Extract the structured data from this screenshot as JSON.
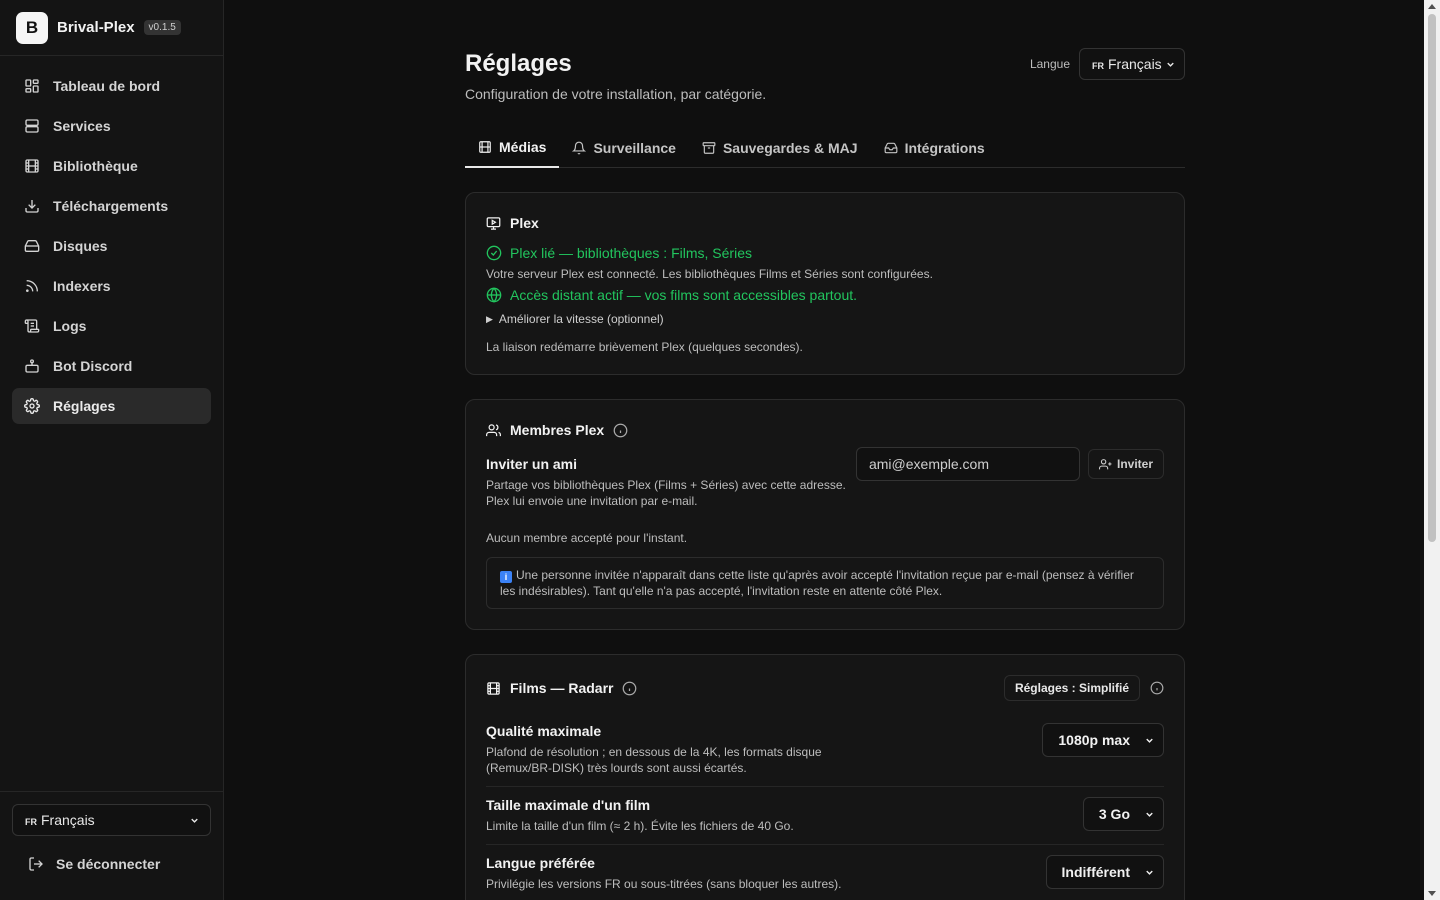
{
  "brand": {
    "logo_letter": "B",
    "name": "Brival-Plex",
    "version": "v0.1.5"
  },
  "sidebar": {
    "items": [
      {
        "label": "Tableau de bord",
        "icon": "dashboard-icon"
      },
      {
        "label": "Services",
        "icon": "server-icon"
      },
      {
        "label": "Bibliothèque",
        "icon": "film-icon"
      },
      {
        "label": "Téléchargements",
        "icon": "download-icon"
      },
      {
        "label": "Disques",
        "icon": "drive-icon"
      },
      {
        "label": "Indexers",
        "icon": "rss-icon"
      },
      {
        "label": "Logs",
        "icon": "logs-icon"
      },
      {
        "label": "Bot Discord",
        "icon": "bot-icon"
      },
      {
        "label": "Réglages",
        "icon": "gear-icon",
        "active": true
      }
    ],
    "language": {
      "flag": "FR",
      "value": "Français"
    },
    "logout_label": "Se déconnecter"
  },
  "header": {
    "title": "Réglages",
    "subtitle": "Configuration de votre installation, par catégorie.",
    "language_label": "Langue",
    "language": {
      "flag": "FR",
      "value": "Français"
    }
  },
  "tabs": [
    {
      "label": "Médias",
      "icon": "film-icon",
      "active": true
    },
    {
      "label": "Surveillance",
      "icon": "bell-icon"
    },
    {
      "label": "Sauvegardes & MAJ",
      "icon": "archive-icon"
    },
    {
      "label": "Intégrations",
      "icon": "inbox-icon"
    }
  ],
  "plex_card": {
    "title": "Plex",
    "status_linked": "Plex lié — bibliothèques : Films, Séries",
    "connected_text": "Votre serveur Plex est connecté. Les bibliothèques Films et Séries sont configurées.",
    "remote_access": "Accès distant actif — vos films sont accessibles partout.",
    "improve_speed": "Améliorer la vitesse (optionnel)",
    "restart_note": "La liaison redémarre brièvement Plex (quelques secondes)."
  },
  "members_card": {
    "title": "Membres Plex",
    "invite_label": "Inviter un ami",
    "invite_desc_1": "Partage vos bibliothèques Plex (Films + Séries) avec cette adresse.",
    "invite_desc_2": "Plex lui envoie une invitation par e-mail.",
    "email_placeholder": "ami@exemple.com",
    "invite_button": "Inviter",
    "no_members": "Aucun membre accepté pour l'instant.",
    "note_badge": "i",
    "note_text": "Une personne invitée n'apparaît dans cette liste qu'après avoir accepté l'invitation reçue par e-mail (pensez à vérifier les indésirables). Tant qu'elle n'a pas accepté, l'invitation reste en attente côté Plex."
  },
  "radarr_card": {
    "title": "Films — Radarr",
    "preset_badge": "Réglages : Simplifié",
    "settings": [
      {
        "label": "Qualité maximale",
        "desc_1": "Plafond de résolution ; en dessous de la 4K, les formats disque",
        "desc_2": "(Remux/BR-DISK) très lourds sont aussi écartés.",
        "value": "1080p max"
      },
      {
        "label": "Taille maximale d'un film",
        "desc_1": "Limite la taille d'un film (≈ 2 h). Évite les fichiers de 40 Go.",
        "desc_2": "",
        "value": "3 Go"
      },
      {
        "label": "Langue préférée",
        "desc_1": "Privilégie les versions FR ou sous-titrées (sans bloquer les autres).",
        "desc_2": "",
        "value": "Indifférent"
      }
    ]
  },
  "colors": {
    "success": "#22c55e",
    "background": "#0f0f0f",
    "sidebar": "#141414",
    "card": "#151515"
  }
}
